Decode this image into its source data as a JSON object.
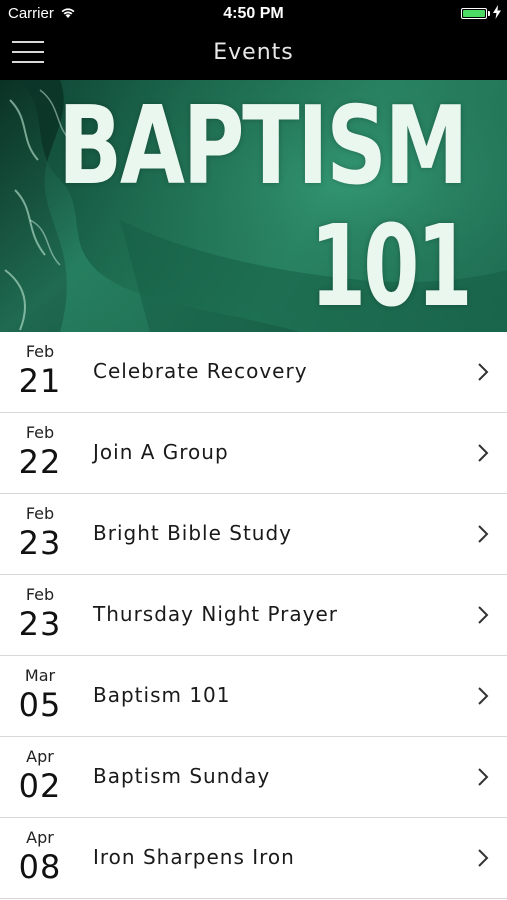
{
  "status_bar": {
    "carrier": "Carrier",
    "time": "4:50 PM",
    "battery_level": 1.0
  },
  "nav": {
    "title": "Events"
  },
  "banner": {
    "line1": "BAPTISM",
    "line2": "101"
  },
  "events": [
    {
      "month": "Feb",
      "day": "21",
      "title": "Celebrate Recovery"
    },
    {
      "month": "Feb",
      "day": "22",
      "title": "Join A Group"
    },
    {
      "month": "Feb",
      "day": "23",
      "title": "Bright Bible Study"
    },
    {
      "month": "Feb",
      "day": "23",
      "title": "Thursday Night Prayer"
    },
    {
      "month": "Mar",
      "day": "05",
      "title": "Baptism 101"
    },
    {
      "month": "Apr",
      "day": "02",
      "title": "Baptism Sunday"
    },
    {
      "month": "Apr",
      "day": "08",
      "title": "Iron Sharpens Iron"
    }
  ],
  "colors": {
    "nav_background": "#000000",
    "banner_green": "#1f7055",
    "battery_green": "#4cd964"
  }
}
